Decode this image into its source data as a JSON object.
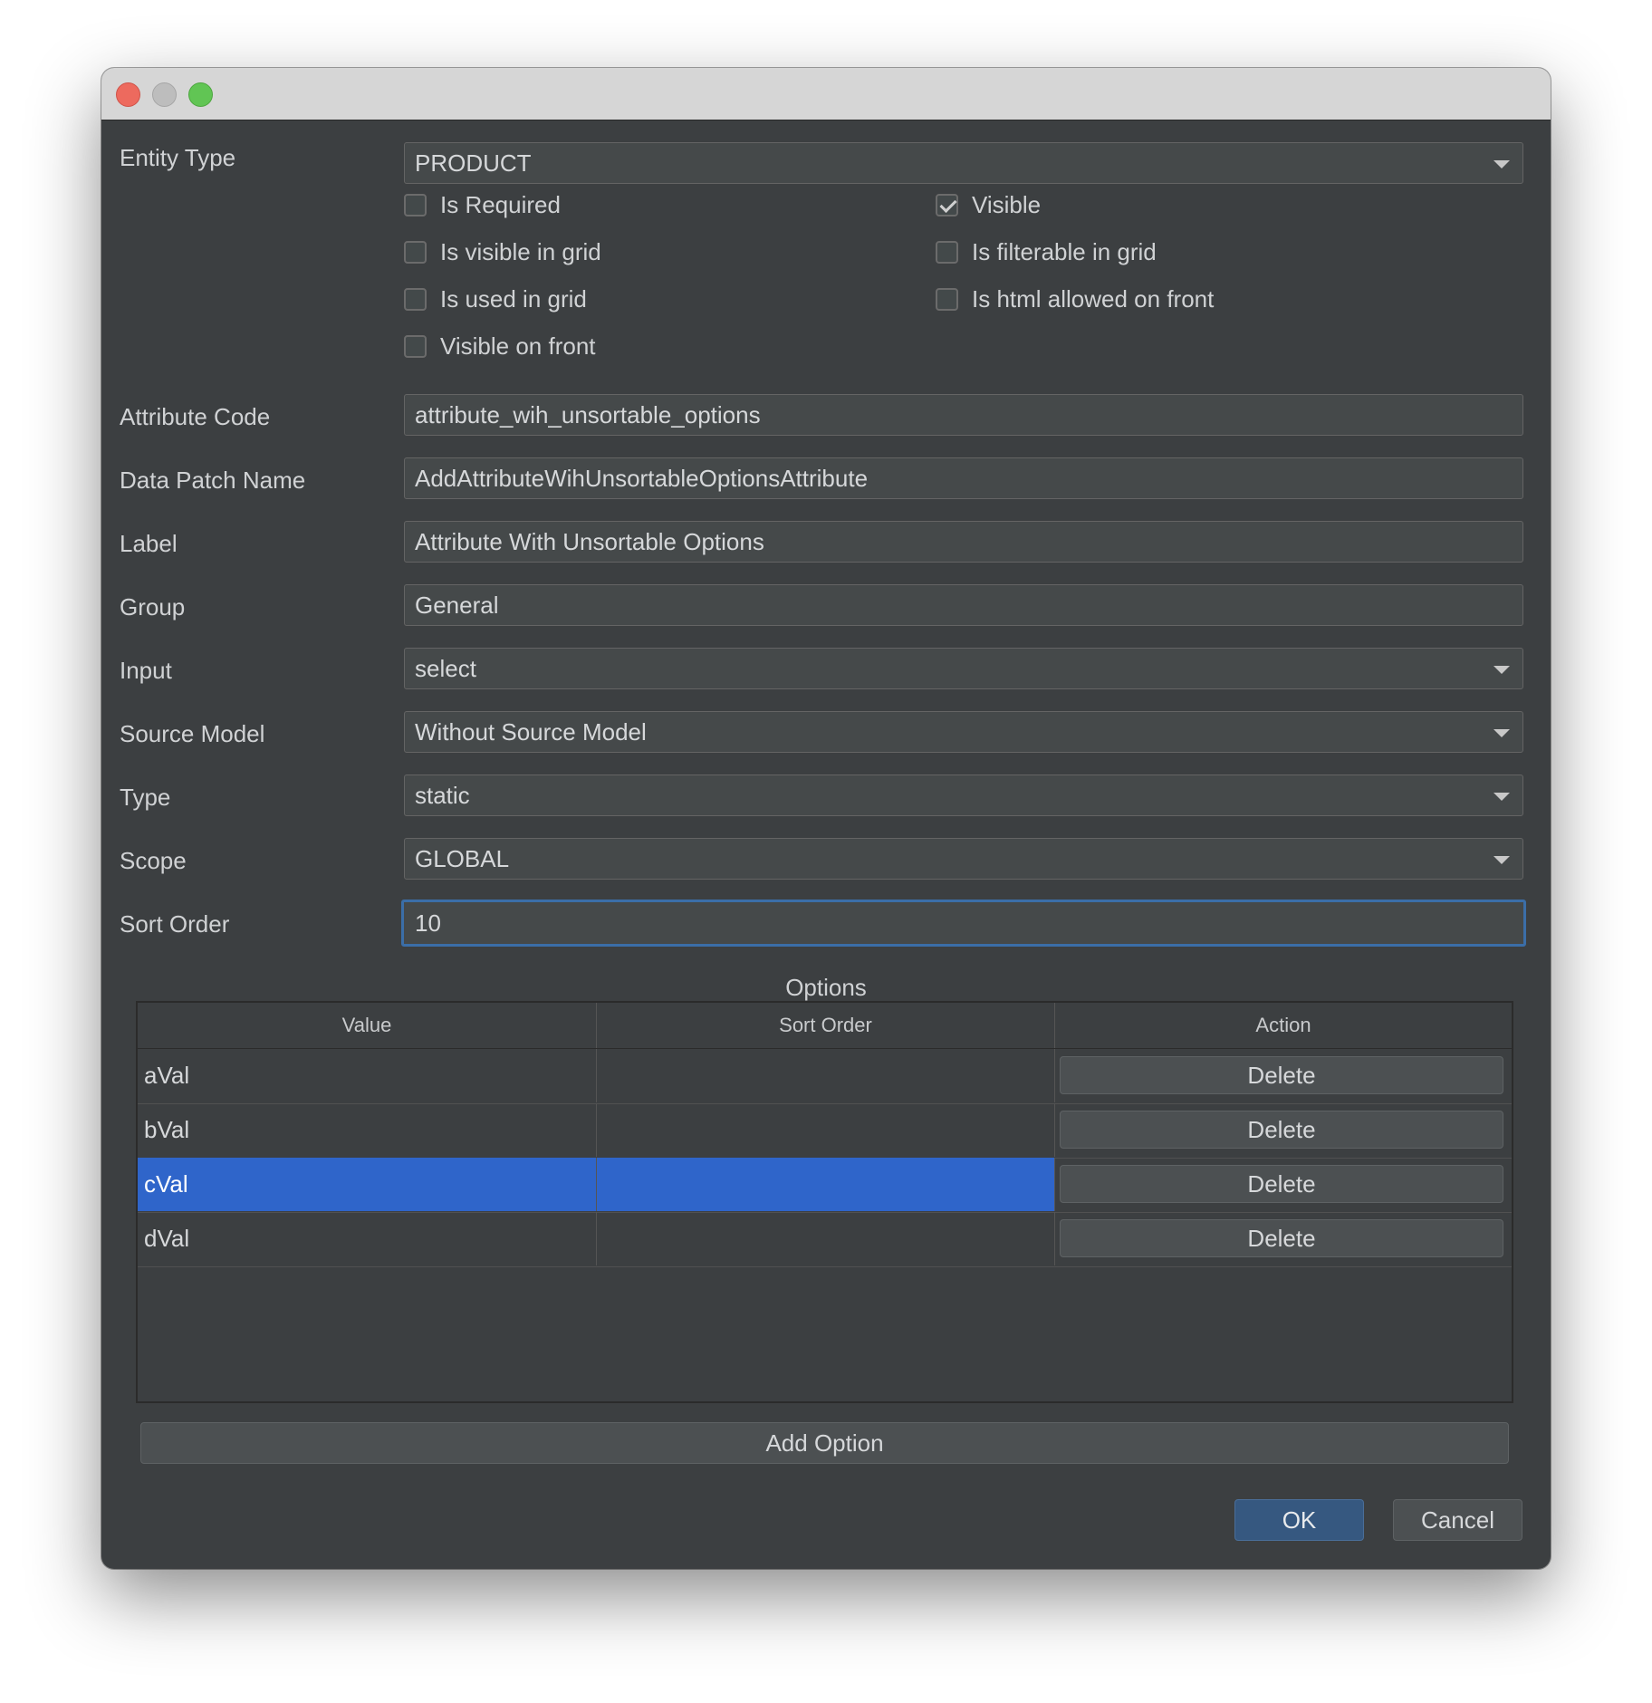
{
  "form": {
    "entity_type": {
      "label": "Entity Type",
      "value": "PRODUCT"
    },
    "checkboxes": {
      "is_required": {
        "label": "Is Required",
        "checked": false
      },
      "visible": {
        "label": "Visible",
        "checked": true
      },
      "is_visible_in_grid": {
        "label": "Is visible in grid",
        "checked": false
      },
      "is_filterable_in_grid": {
        "label": "Is filterable in grid",
        "checked": false
      },
      "is_used_in_grid": {
        "label": "Is used in grid",
        "checked": false
      },
      "is_html_allowed_on_front": {
        "label": "Is html allowed on front",
        "checked": false
      },
      "visible_on_front": {
        "label": "Visible on front",
        "checked": false
      }
    },
    "attribute_code": {
      "label": "Attribute Code",
      "value": "attribute_wih_unsortable_options"
    },
    "data_patch_name": {
      "label": "Data Patch Name",
      "value": "AddAttributeWihUnsortableOptionsAttribute"
    },
    "label_field": {
      "label": "Label",
      "value": "Attribute With Unsortable Options"
    },
    "group": {
      "label": "Group",
      "value": "General"
    },
    "input": {
      "label": "Input",
      "value": "select"
    },
    "source_model": {
      "label": "Source Model",
      "value": "Without Source Model"
    },
    "type": {
      "label": "Type",
      "value": "static"
    },
    "scope": {
      "label": "Scope",
      "value": "GLOBAL"
    },
    "sort_order": {
      "label": "Sort Order",
      "value": "10"
    }
  },
  "options": {
    "title": "Options",
    "headers": [
      "Value",
      "Sort Order",
      "Action"
    ],
    "rows": [
      {
        "value": "aVal",
        "sort_order": "",
        "action": "Delete"
      },
      {
        "value": "bVal",
        "sort_order": "",
        "action": "Delete"
      },
      {
        "value": "cVal",
        "sort_order": "",
        "action": "Delete",
        "selected": true
      },
      {
        "value": "dVal",
        "sort_order": "",
        "action": "Delete"
      }
    ],
    "add_label": "Add Option"
  },
  "buttons": {
    "ok": "OK",
    "cancel": "Cancel"
  },
  "colors": {
    "accent": "#365880",
    "selection": "#2f65ca",
    "focus_border": "#3b6ea8",
    "panel": "#3c3f41"
  }
}
